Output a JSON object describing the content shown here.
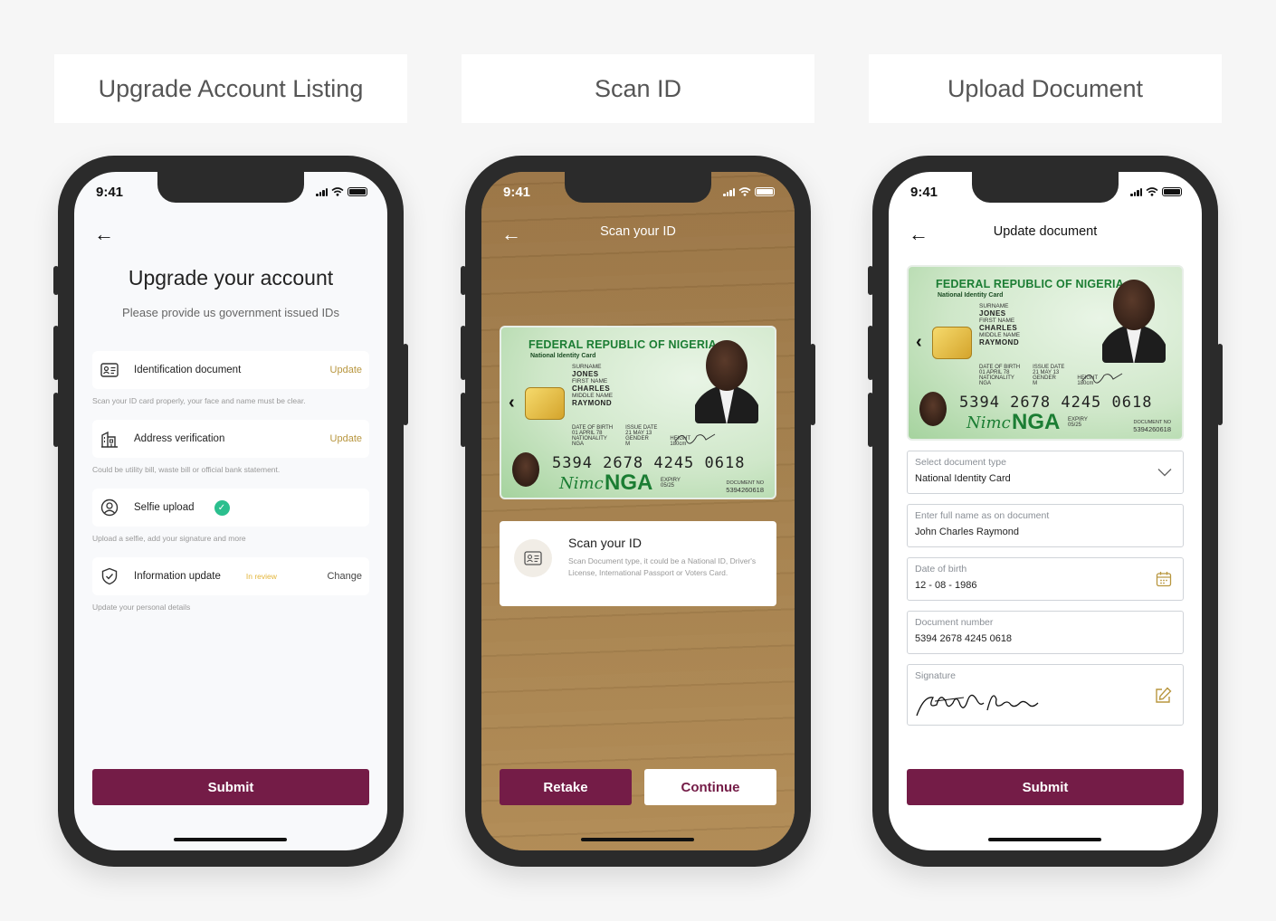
{
  "labels": {
    "left": "Upgrade Account Listing",
    "center": "Scan ID",
    "right": "Upload Document"
  },
  "status": {
    "time": "9:41"
  },
  "screen1": {
    "title": "Upgrade your account",
    "subtitle": "Please provide us government issued IDs",
    "items": [
      {
        "label": "Identification document",
        "action": "Update",
        "hint": "Scan your ID card properly, your face and name must be clear."
      },
      {
        "label": "Address verification",
        "action": "Update",
        "hint": "Could be utility bill, waste bill or official bank statement."
      },
      {
        "label": "Selfie upload",
        "action": "",
        "hint": "Upload a selfie, add your signature and more"
      },
      {
        "label": "Information update",
        "status": "In review",
        "action": "Change",
        "hint": "Update your personal details"
      }
    ],
    "submit": "Submit"
  },
  "screen2": {
    "title": "Scan your ID",
    "card_heading": "Scan your ID",
    "card_desc": "Scan Document type, it could be a National ID, Driver's License, International Passport or Voters Card.",
    "retake": "Retake",
    "continue": "Continue"
  },
  "idcard": {
    "country": "FEDERAL REPUBLIC OF NIGERIA",
    "card_type": "National Identity Card",
    "surname_label": "SURNAME",
    "surname": "JONES",
    "first_name_label": "FIRST NAME",
    "first_name": "CHARLES",
    "middle_name_label": "MIDDLE NAME",
    "middle_name": "RAYMOND",
    "dob_label": "DATE OF BIRTH",
    "dob": "01 APRIL 78",
    "issue_label": "ISSUE DATE",
    "issue": "21 MAY 13",
    "nationality_label": "NATIONALITY",
    "nationality": "NGA",
    "gender_label": "GENDER",
    "gender": "M",
    "height_label": "HEIGHT",
    "height": "180cm",
    "nin": "5394 2678 4245 0618",
    "brand": "Nimc",
    "code": "NGA",
    "expiry_label": "EXPIRY",
    "expiry": "05/25",
    "docno_label": "DOCUMENT NO",
    "docno": "5394260618"
  },
  "screen3": {
    "title": "Update document",
    "fields": [
      {
        "label": "Select document type",
        "value": "National Identity Card"
      },
      {
        "label": "Enter full name as on document",
        "value": "John Charles Raymond"
      },
      {
        "label": "Date of birth",
        "value": "12 - 08 - 1986"
      },
      {
        "label": "Document number",
        "value": "5394 2678 4245 0618"
      },
      {
        "label": "Signature",
        "value": ""
      }
    ],
    "submit": "Submit"
  },
  "colors": {
    "primary": "#741c47",
    "accent": "#b8963f",
    "success": "#2bbf8e",
    "pending": "#e3b53a"
  },
  "icons": [
    "back-arrow-icon",
    "id-card-icon",
    "building-icon",
    "user-circle-icon",
    "shield-check-icon",
    "check-icon",
    "chevron-down-icon",
    "calendar-icon",
    "edit-icon",
    "signal-icon",
    "wifi-icon",
    "battery-icon"
  ]
}
